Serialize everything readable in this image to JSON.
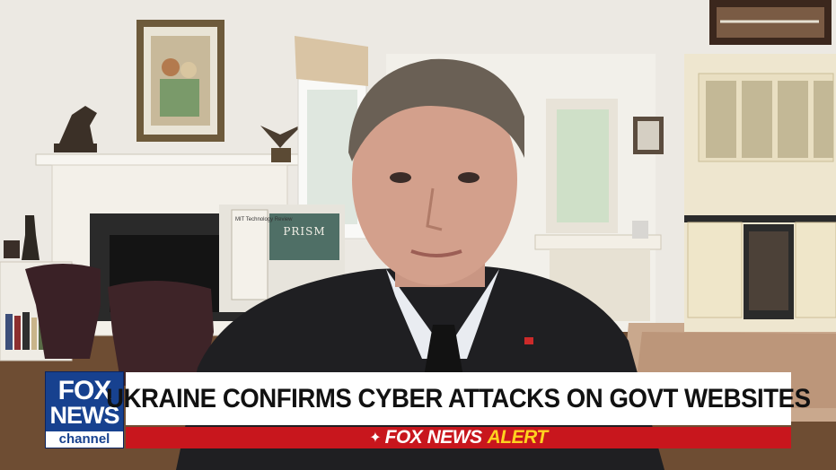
{
  "background": {
    "book_title": "PRISM",
    "magazine_text": "MIT Technology Review"
  },
  "chyron": {
    "logo_line1": "FOX",
    "logo_line2": "NEWS",
    "logo_line3": "channel",
    "headline": "UKRAINE CONFIRMS CYBER ATTACKS ON GOVT WEBSITES",
    "alert_brand": "FOX NEWS",
    "alert_word": "ALERT"
  },
  "colors": {
    "logo_blue": "#17418f",
    "alert_red": "#c8161d",
    "alert_yellow": "#ffd21f"
  }
}
